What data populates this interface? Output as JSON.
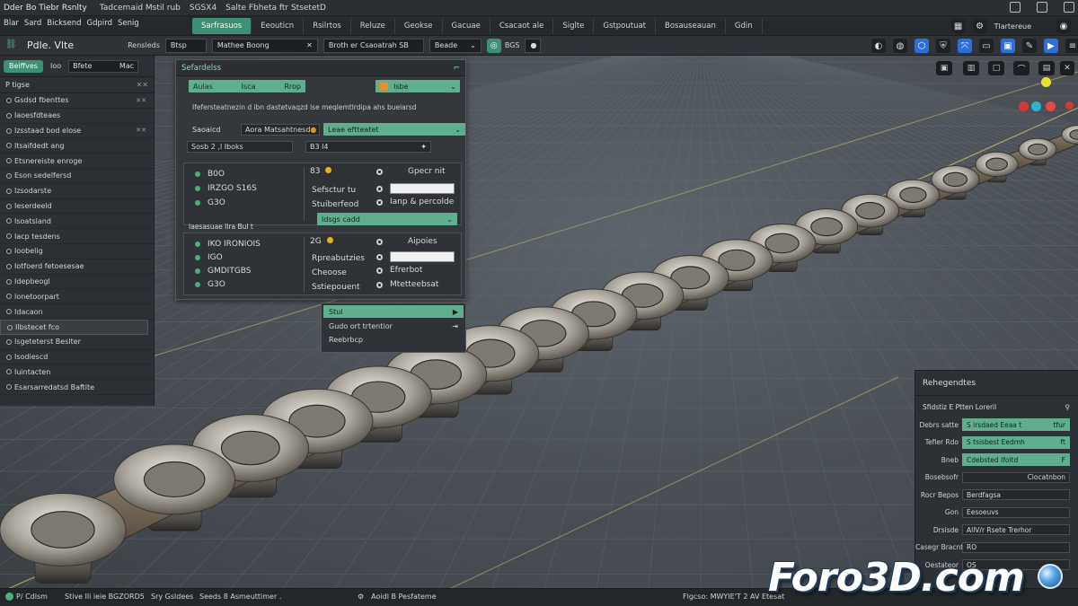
{
  "menubar": {
    "title": "Dder Bo Tiebr Rsnlty",
    "items": [
      "Tadcemaid Mstil rub",
      "SGSX4",
      "Salte Fbheta ftr StsetetD"
    ],
    "sub_items": [
      "Blar",
      "Sard",
      "Bicksend",
      "Gdpird",
      "Senig"
    ]
  },
  "tabs": {
    "items": [
      {
        "label": "Sarfrasuos",
        "active": true
      },
      {
        "label": "Eeouticn",
        "active": false
      },
      {
        "label": "Rsilrtos",
        "active": false
      },
      {
        "label": "Reluze",
        "active": false
      },
      {
        "label": "Geokse",
        "active": false
      },
      {
        "label": "Gacuae",
        "active": false
      },
      {
        "label": "Csacaot ale",
        "active": false
      },
      {
        "label": "Siglte",
        "active": false
      },
      {
        "label": "Gstpoutuat",
        "active": false
      },
      {
        "label": "Bosauseauan",
        "active": false
      },
      {
        "label": "Gdin",
        "active": false
      }
    ],
    "right_label": "Tlartereue"
  },
  "toolrow": {
    "title": "Pdle. Vlte",
    "label_1": "Rensleds",
    "input_1": "Btsp",
    "input_2": "Mathee Boong",
    "input_3": "Broth er Csaoatrah SB",
    "input_4": "Beade",
    "label_2": "BGS"
  },
  "leftpanel": {
    "head_pill": "Beiffves",
    "head_label": "Ioo",
    "head_field": "Bfete",
    "head_field_right": "Mac",
    "sub_label": "P tigse",
    "items": [
      "Gsdsd fbenttes",
      "Iaoesfdteaes",
      "Izsstaad bod elose",
      "Itsaifdedt ang",
      "Etsnereiste enroge",
      "Eson sedelfersd",
      "Izsodarste",
      "Ieserdeeld",
      "Isoatsland",
      "Iacp tesdens",
      "Ioobelig",
      "Iotfoerd fetoesesae",
      "Idepbeogl",
      "Ionetoorpart",
      "Idacaon",
      "Ilbstecet fco",
      "Isgeteterst Beslter",
      "Isodiescd",
      "Iuintacten",
      "Esarsarredatsd Baftite"
    ]
  },
  "dialog": {
    "title": "Sefardelss",
    "aulas_label": "Aulas",
    "aulas_button": "Isca",
    "aulas_tag": "Rrop",
    "orange_label": "Isbe",
    "description": "Ifefersteatnezin d ibn dastetvaqzd ise meqlemtlrdipa ahs bueiarsd",
    "search_label": "Saoaicd",
    "search_value": "Aora Matsahtnesd",
    "search_dropdown": "Leae eftteatet",
    "sub_label": "Sosb 2 ,l Iboks",
    "sub_value": "B3 l4",
    "box1": {
      "items": [
        "B0O",
        "IRZGO S16S",
        "G3O"
      ],
      "num": "83",
      "rows": [
        "Sefsctur tu",
        "Stuiberfeod"
      ],
      "right_top": "Gpecr nit",
      "right_field": "",
      "right_desc": "Ianp & percolde",
      "dropdown": "Idsgs cadd"
    },
    "box2_header": "Iaesasuae Ilra Bul t",
    "box2": {
      "items": [
        "IKO IRONIOIS",
        "IGO",
        "GMDITGBS",
        "G3O"
      ],
      "num": "2G",
      "rows": [
        "Rpreabutzies",
        "Cheoose",
        "Sstiepouent"
      ],
      "right_top": "Aipoies",
      "right_mid": "Efrerbot",
      "right_bottom": "Mtetteebsat"
    }
  },
  "dropdown": {
    "selected": "Stul",
    "options": [
      "Gudo ort trtentior",
      "Reebrbcp"
    ]
  },
  "rightpanel": {
    "title": "Rehegendtes",
    "subtitle": "Sfidstiz E Ptten Loreril",
    "rows": [
      {
        "label": "Debrs satte",
        "value": "S irsdaed Eeaa t",
        "value2": "tfur",
        "kind": "green"
      },
      {
        "label": "Tefier Rdo",
        "value": "S tsisbest Eedmh",
        "value2": "ft",
        "kind": "green"
      },
      {
        "label": "Bneb",
        "value": "Cdebsted Ifoltd",
        "value2": "F",
        "kind": "green"
      },
      {
        "label": "Bosebsofr",
        "value": "",
        "value2": "Ciocatnbon",
        "kind": "dark"
      },
      {
        "label": "Rocr Bepos",
        "value": "Berdfagsa",
        "value2": "",
        "kind": "dark"
      },
      {
        "label": "Gon",
        "value": "Eesoeuvs",
        "value2": "",
        "kind": "dark"
      },
      {
        "label": "Drsisde",
        "value": "AllV/r Rsete Trerhor",
        "value2": "",
        "kind": "dark"
      },
      {
        "label": "Casegr Bracnt Rrs",
        "value": "RO",
        "value2": "",
        "kind": "dark"
      },
      {
        "label": "Oestateor",
        "value": "OS",
        "value2": "",
        "kind": "dark"
      }
    ]
  },
  "statusbar": {
    "item_1": "P/ Cdlsm",
    "item_2": "Stive lli ieie BGZORD5",
    "item_3": "Sry Gsldees",
    "item_4": "Seeds 8 Asmeuttimer .",
    "item_5": "Aoidl B Pesfateme",
    "item_6": "Flgcso: MWYIE'T 2 AV Etesat"
  },
  "watermark": {
    "text": "Foro3D.com"
  },
  "colors": {
    "accent_green": "#5fae8d",
    "active_tab": "#3e8f73",
    "orange": "#e0922a",
    "yellow": "#e4b426",
    "blue": "#2d6fd6"
  }
}
